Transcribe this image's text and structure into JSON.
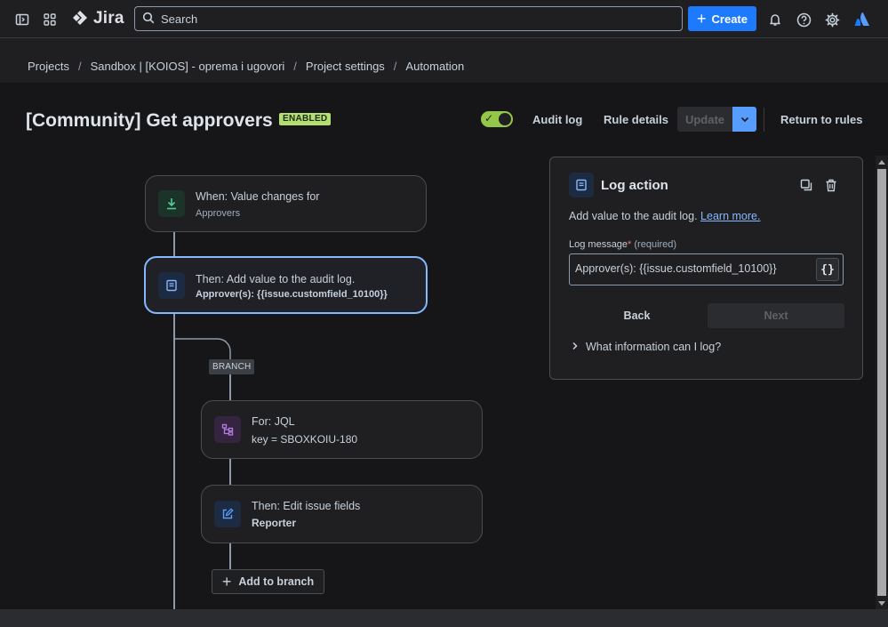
{
  "topbar": {
    "app_name": "Jira",
    "search_placeholder": "Search",
    "create_label": "Create"
  },
  "breadcrumb": {
    "items": [
      "Projects",
      "Sandbox | [KOIOS] - oprema i ugovori",
      "Project settings",
      "Automation"
    ],
    "separator": "/"
  },
  "header": {
    "title": "[Community] Get approvers",
    "status_badge": "ENABLED",
    "audit_log": "Audit log",
    "rule_details": "Rule details",
    "update": "Update",
    "return_to_rules": "Return to rules"
  },
  "flow": {
    "trigger": {
      "title": "When: Value changes for",
      "subtitle": "Approvers"
    },
    "action": {
      "title": "Then: Add value to the audit log.",
      "subtitle": "Approver(s): {{issue.customfield_10100}}"
    },
    "branch_label": "BRANCH",
    "branch_for": {
      "title": "For: JQL",
      "subtitle": "key = SBOXKOIU-180"
    },
    "branch_edit": {
      "title": "Then: Edit issue fields",
      "subtitle": "Reporter"
    },
    "add_to_branch": "Add to branch"
  },
  "panel": {
    "title": "Log action",
    "description": "Add value to the audit log.",
    "learn_more": "Learn more.",
    "field_label": "Log message",
    "required_star": "*",
    "required_text": "(required)",
    "field_value": "Approver(s): {{issue.customfield_10100}}",
    "braces": "{}",
    "back": "Back",
    "next": "Next",
    "expander": "What information can I log?"
  },
  "colors": {
    "accent": "#1d7afc",
    "enabled_badge": "#b3df72",
    "toggle_on": "#94c748",
    "selected_border": "#85b8ff",
    "trigger_icon": "#4bce97",
    "branch_icon": "#b37ee0"
  }
}
